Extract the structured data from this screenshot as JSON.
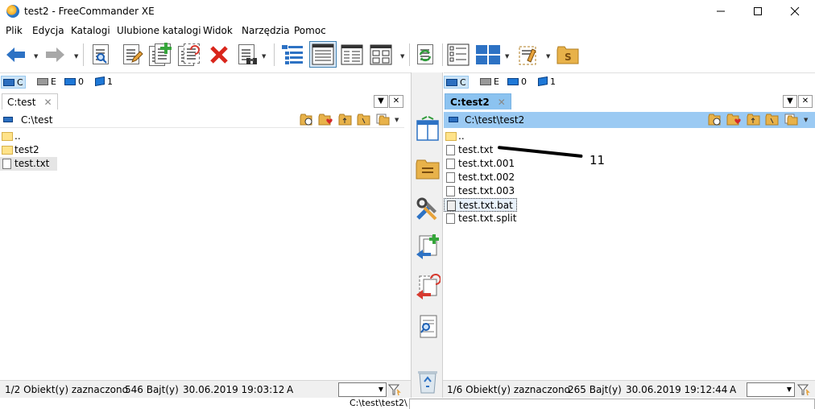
{
  "window": {
    "title": "test2 - FreeCommander XE",
    "minimize_icon": "minimize-icon",
    "maximize_icon": "maximize-icon",
    "close_icon": "close-icon"
  },
  "menu": [
    "Plik",
    "Edycja",
    "Katalogi",
    "Ulubione katalogi",
    "Widok",
    "Narzędzia",
    "Pomoc"
  ],
  "drives": {
    "c": "C",
    "e": "E",
    "net0": "0",
    "net1": "1"
  },
  "left": {
    "tab": "C:test",
    "tab_close": "✕",
    "path": "C:\\test",
    "files": [
      {
        "name": "..",
        "type": "folder"
      },
      {
        "name": "test2",
        "type": "folder"
      },
      {
        "name": "test.txt",
        "type": "file"
      }
    ],
    "status": {
      "objects": "1/2 Obiekt(y) zaznaczono",
      "size": "546 Bajt(y)",
      "date": "30.06.2019 19:03:12",
      "attr": "A"
    }
  },
  "right": {
    "tab": "C:test2",
    "tab_close": "✕",
    "path": "C:\\test\\test2",
    "files": [
      {
        "name": "..",
        "type": "folder"
      },
      {
        "name": "test.txt",
        "type": "file"
      },
      {
        "name": "test.txt.001",
        "type": "file"
      },
      {
        "name": "test.txt.002",
        "type": "file"
      },
      {
        "name": "test.txt.003",
        "type": "file"
      },
      {
        "name": "test.txt.bat",
        "type": "file"
      },
      {
        "name": "test.txt.split",
        "type": "file"
      }
    ],
    "status": {
      "objects": "1/6 Obiekt(y) zaznaczono",
      "size": "265 Bajt(y)",
      "date": "30.06.2019 19:12:44",
      "attr": "A"
    }
  },
  "panel_controls": {
    "dropdown": "▼",
    "close": "✕"
  },
  "command_line": "C:\\test\\test2\\",
  "annotation": "11",
  "colors": {
    "accent": "#9bcaf3",
    "tab_active": "#8cc3f0"
  }
}
